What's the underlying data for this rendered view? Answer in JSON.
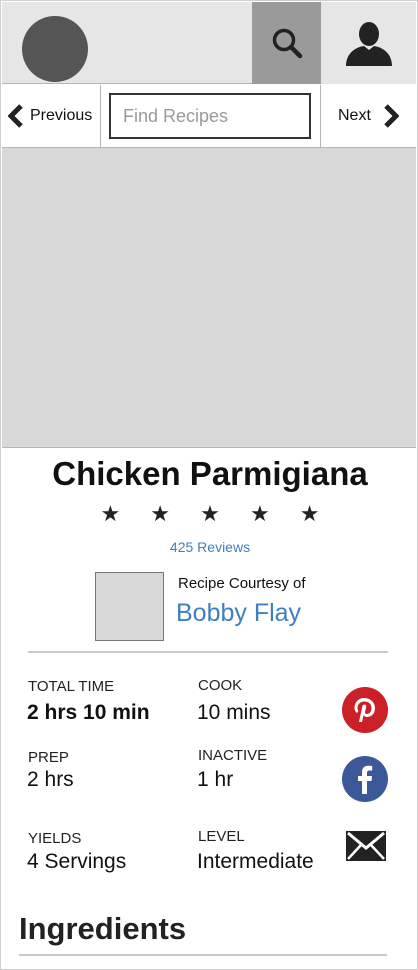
{
  "header": {
    "logo_icon": "logo-placeholder",
    "search_icon": "search-icon",
    "user_icon": "user-icon"
  },
  "nav": {
    "previous_label": "Previous",
    "search_placeholder": "Find Recipes",
    "search_value": "",
    "next_label": "Next"
  },
  "recipe": {
    "title": "Chicken Parmigiana",
    "rating_stars": "★ ★ ★ ★ ★",
    "rating": 5,
    "reviews_label": "425 Reviews",
    "courtesy_label": "Recipe Courtesy of",
    "author": "Bobby Flay"
  },
  "details": {
    "total_time_label": "TOTAL TIME",
    "total_time_value": "2 hrs 10 min",
    "cook_label": "COOK",
    "cook_value": "10 mins",
    "prep_label": "PREP",
    "prep_value": "2 hrs",
    "inactive_label": "INACTIVE",
    "inactive_value": "1 hr",
    "yields_label": "YIELDS",
    "yields_value": "4 Servings",
    "level_label": "LEVEL",
    "level_value": "Intermediate"
  },
  "share": {
    "pinterest_icon": "pinterest-icon",
    "pinterest_color": "#cb2027",
    "facebook_icon": "facebook-icon",
    "facebook_color": "#3b5998",
    "email_icon": "email-icon"
  },
  "sections": {
    "ingredients_heading": "Ingredients"
  },
  "colors": {
    "link": "#3f7fc0",
    "placeholder_gray": "#d8d8d8",
    "header_gray": "#e6e6e6",
    "search_active": "#9a9a9a"
  }
}
